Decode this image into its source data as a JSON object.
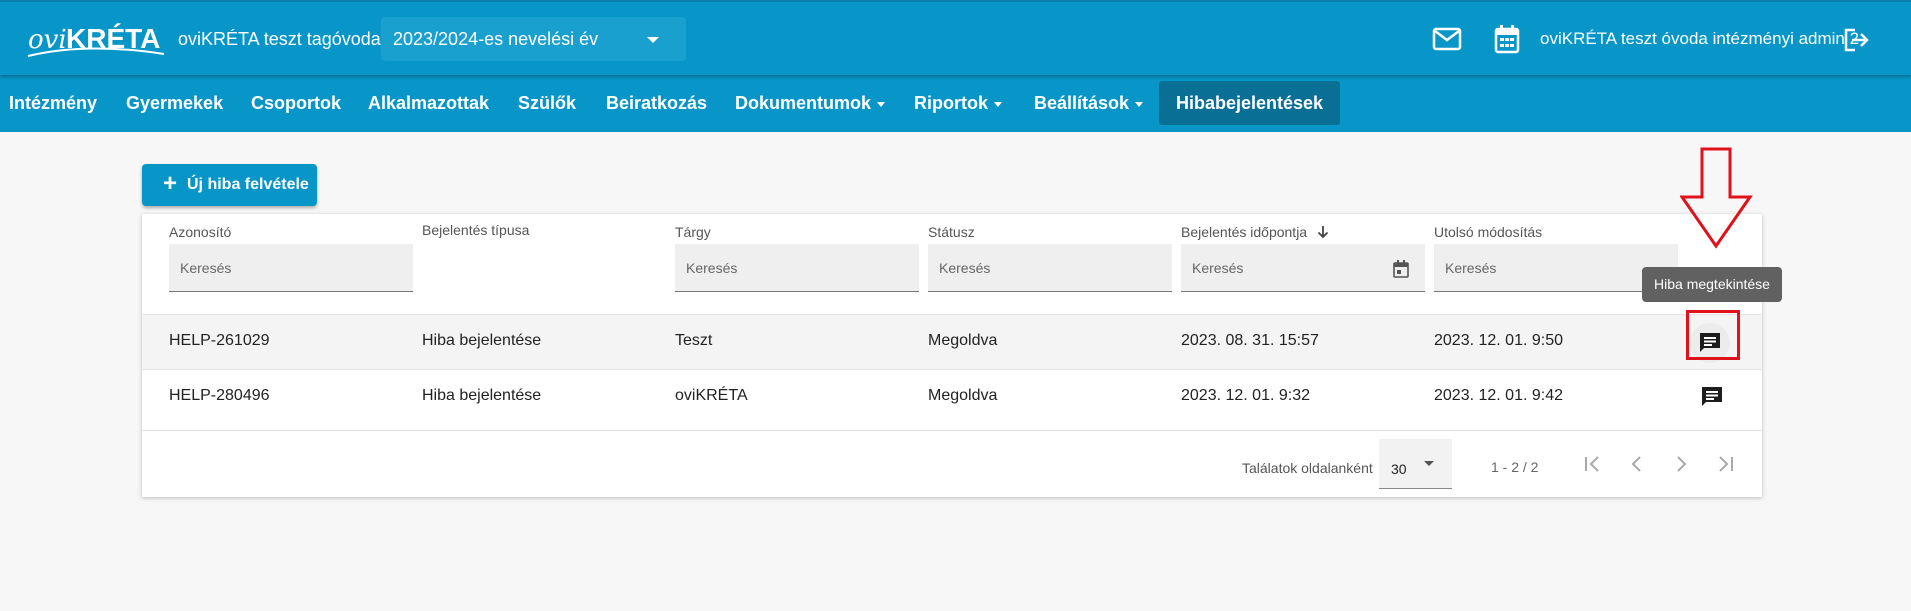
{
  "header": {
    "logo_text": "oviKRÉTA",
    "school_name": "oviKRÉTA teszt tagóvoda",
    "year_select": "2023/2024-es nevelési év",
    "user_name": "oviKRÉTA teszt óvoda intézményi admin 2",
    "icons": [
      "mail-icon",
      "calendar-icon",
      "logout-icon"
    ]
  },
  "nav": {
    "items": [
      {
        "label": "Intézmény"
      },
      {
        "label": "Gyermekek"
      },
      {
        "label": "Csoportok"
      },
      {
        "label": "Alkalmazottak"
      },
      {
        "label": "Szülők"
      },
      {
        "label": "Beiratkozás"
      },
      {
        "label": "Dokumentumok"
      },
      {
        "label": "Riportok"
      },
      {
        "label": "Beállítások"
      },
      {
        "label": "Hibabejelentések"
      }
    ],
    "active": "Hibabejelentések"
  },
  "toolbar": {
    "add_button_label": "Új hiba felvétele"
  },
  "table": {
    "columns": [
      {
        "header": "Azonosító",
        "filter_placeholder": "Keresés"
      },
      {
        "header": "Bejelentés típusa"
      },
      {
        "header": "Tárgy",
        "filter_placeholder": "Keresés"
      },
      {
        "header": "Státusz",
        "filter_placeholder": "Keresés"
      },
      {
        "header": "Bejelentés időpontja",
        "filter_placeholder": "Keresés",
        "sort": "descending"
      },
      {
        "header": "Utolsó módosítás",
        "filter_placeholder": "Keresés"
      }
    ],
    "rows": [
      {
        "id": "HELP-261029",
        "type": "Hiba bejelentése",
        "subject": "Teszt",
        "status": "Megoldva",
        "reported": "2023. 08. 31. 15:57",
        "modified": "2023. 12. 01. 9:50"
      },
      {
        "id": "HELP-280496",
        "type": "Hiba bejelentése",
        "subject": "oviKRÉTA",
        "status": "Megoldva",
        "reported": "2023. 12. 01. 9:32",
        "modified": "2023. 12. 01. 9:42"
      }
    ],
    "row_action_tooltip": "Hiba megtekintése"
  },
  "pagination": {
    "per_page_label": "Találatok oldalanként",
    "per_page_value": "30",
    "range": "1 - 2 / 2"
  },
  "colors": {
    "primary": "#0896c8",
    "active_nav": "#0a6f94",
    "highlight": "#e0111b",
    "tooltip_bg": "#616161"
  }
}
